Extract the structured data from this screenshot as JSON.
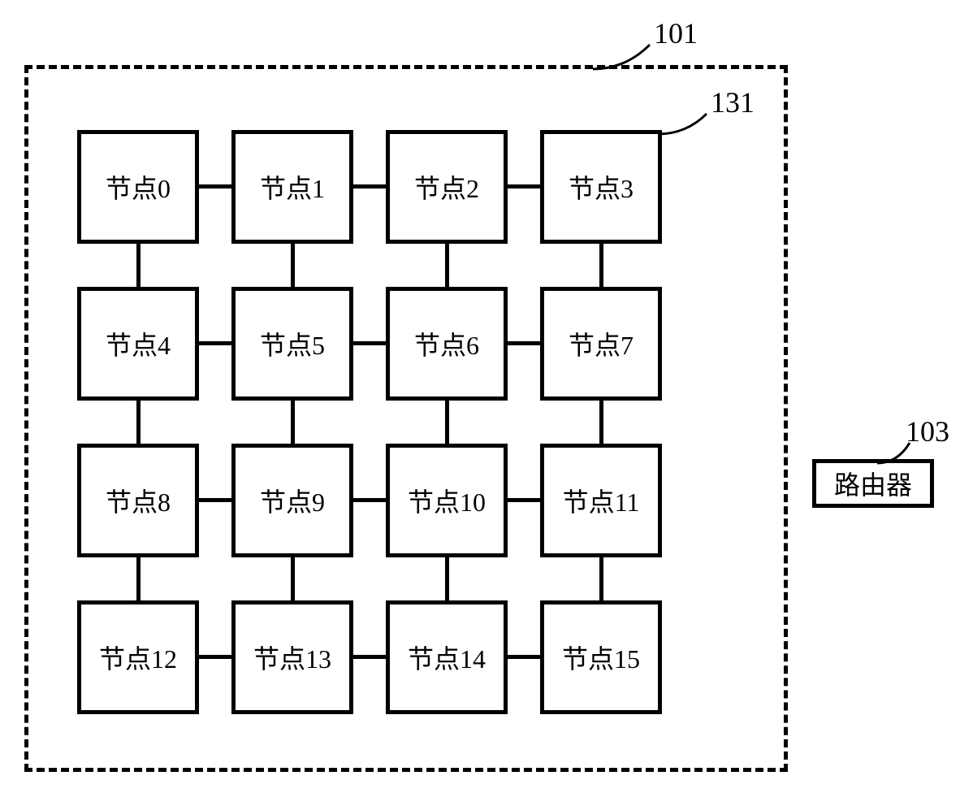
{
  "labels": {
    "outer": "101",
    "inner": "131",
    "router": "103"
  },
  "nodes": {
    "n0": "节点0",
    "n1": "节点1",
    "n2": "节点2",
    "n3": "节点3",
    "n4": "节点4",
    "n5": "节点5",
    "n6": "节点6",
    "n7": "节点7",
    "n8": "节点8",
    "n9": "节点9",
    "n10": "节点10",
    "n11": "节点11",
    "n12": "节点12",
    "n13": "节点13",
    "n14": "节点14",
    "n15": "节点15"
  },
  "router": {
    "label": "路由器"
  }
}
